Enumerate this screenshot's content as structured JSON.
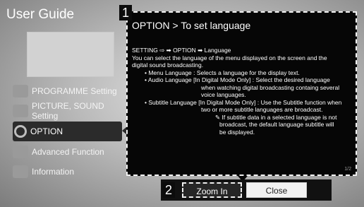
{
  "header": {
    "title": "User Guide"
  },
  "menu": {
    "items": [
      {
        "label": "PROGRAMME Setting",
        "icon": "tv-icon",
        "active": false
      },
      {
        "label": "PICTURE, SOUND Setting",
        "icon": "picture-sound-icon",
        "active": false
      },
      {
        "label": "OPTION",
        "icon": "option-icon",
        "active": true
      },
      {
        "label": "Advanced Function",
        "icon": "advanced-icon",
        "active": false
      },
      {
        "label": "Information",
        "icon": "information-icon",
        "active": false
      }
    ]
  },
  "badges": {
    "one": "1",
    "two": "2"
  },
  "panel": {
    "heading": "OPTION > To set language",
    "lines": [
      "SETTING ⇨ ➡ OPTION ➡ Language",
      "You can select the language of the menu displayed on the screen and the",
      "digital sound broadcasting.",
      "• Menu Language : Selects a language for the display text.",
      "• Audio Language  [In Digital Mode Only] : Select the desired language",
      "when watching digital broadcasting containg several",
      "voice languages.",
      "• Subtitle Language [In Digital Mode Only] : Use the Subtitle function when",
      "two or more subtitle languages are broadcast.",
      "✎ If subtitle data in a selected language is not",
      "broadcast, the default language subtitle will",
      "be displayed."
    ],
    "pager": "1/2"
  },
  "buttons": {
    "zoom_in": "Zoom In",
    "close": "Close"
  }
}
